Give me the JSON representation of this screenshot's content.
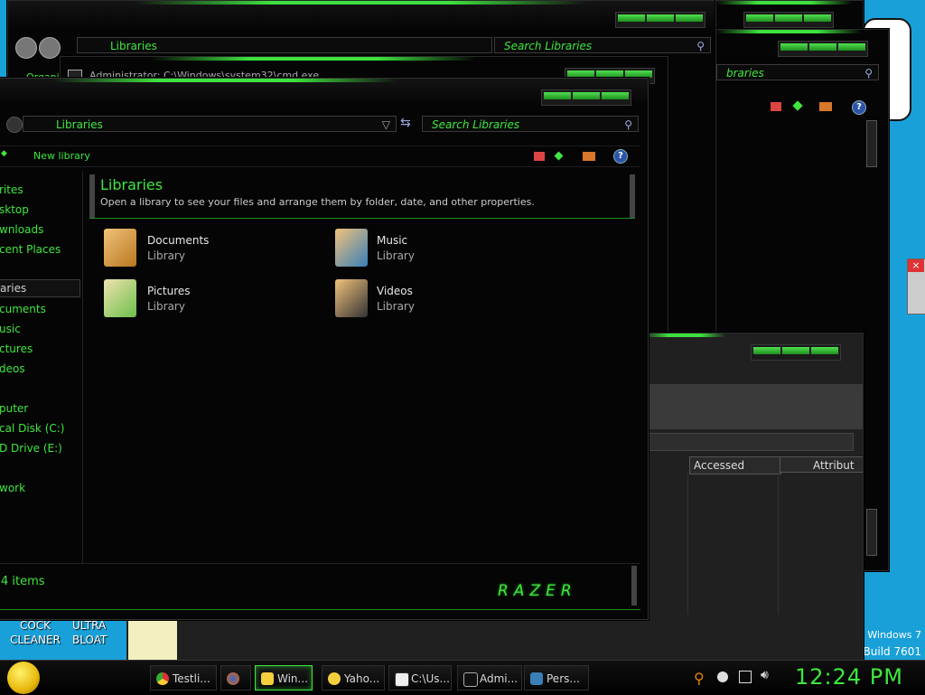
{
  "desktop": {
    "icon_labels": [
      "COCK\nCLEANER",
      "ULTRA\nBLOAT"
    ],
    "watermark": [
      "Windows 7",
      "Build 7601"
    ]
  },
  "back_windows": {
    "top_window": {
      "address_text": "Libraries",
      "search_placeholder": "Search Libraries",
      "organize_label": "Organi"
    },
    "right_window": {
      "search_placeholder_partial": "braries"
    },
    "cmd_window": {
      "title": "Administrator: C:\\Windows\\system32\\cmd.exe"
    },
    "details_window": {
      "columns": [
        "Accessed",
        "Attribut"
      ]
    }
  },
  "main_window": {
    "address_text": "Libraries",
    "search_placeholder": "Search Libraries",
    "toolbar": {
      "new_library_label": "New library"
    },
    "header": {
      "title": "Libraries",
      "subtitle": "Open a library to see your files and arrange them by folder, date, and other properties."
    },
    "nav_items": [
      "rites",
      "sktop",
      "wnloads",
      "cent Places",
      "aries",
      "cuments",
      "usic",
      "ctures",
      "deos",
      "puter",
      "cal Disk (C:)",
      "D Drive (E:)",
      "work"
    ],
    "libraries": [
      {
        "name": "Documents",
        "type": "Library",
        "icon": "documents-library-icon"
      },
      {
        "name": "Music",
        "type": "Library",
        "icon": "music-library-icon"
      },
      {
        "name": "Pictures",
        "type": "Library",
        "icon": "pictures-library-icon"
      },
      {
        "name": "Videos",
        "type": "Library",
        "icon": "videos-library-icon"
      }
    ],
    "status": {
      "item_count": "4 items",
      "brand_logo_text": "RAZER"
    }
  },
  "taskbar": {
    "buttons": [
      {
        "label": "Testli...",
        "icon": "chrome-icon"
      },
      {
        "label": "",
        "icon": "firefox-icon"
      },
      {
        "label": "Win...",
        "icon": "explorer-folder-icon",
        "active": true
      },
      {
        "label": "Yaho...",
        "icon": "yahoo-messenger-icon"
      },
      {
        "label": "C:\\Us...",
        "icon": "7zip-icon"
      },
      {
        "label": "Admi...",
        "icon": "cmd-icon"
      },
      {
        "label": "Pers...",
        "icon": "personalize-icon"
      }
    ],
    "clock": "12:24 PM"
  },
  "colors": {
    "accent": "#3ee63e",
    "desktop": "#1aa0d8",
    "window_bg": "#050505"
  }
}
